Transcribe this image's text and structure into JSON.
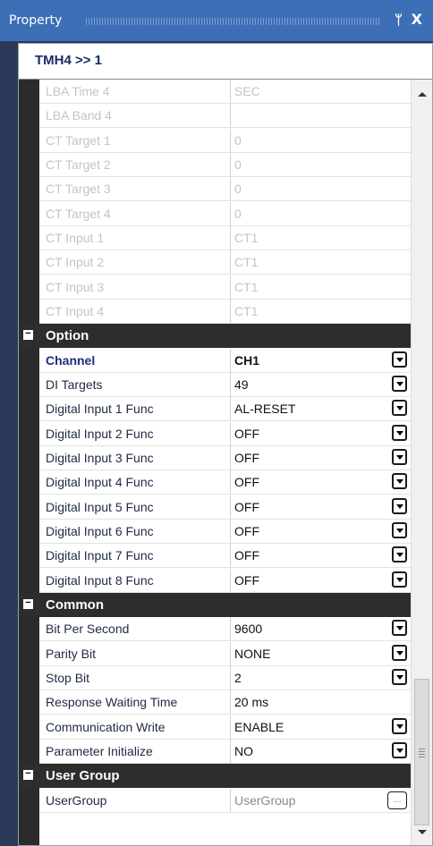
{
  "title": "Property",
  "header": "TMH4 >> 1",
  "sections": [
    {
      "type": "rows",
      "rows": [
        {
          "name": "LBA Time 4",
          "value": "SEC",
          "state": "disabled"
        },
        {
          "name": "LBA Band 4",
          "value": "",
          "state": "disabled"
        },
        {
          "name": "CT Target 1",
          "value": "0",
          "state": "disabled"
        },
        {
          "name": "CT Target 2",
          "value": "0",
          "state": "disabled"
        },
        {
          "name": "CT Target 3",
          "value": "0",
          "state": "disabled"
        },
        {
          "name": "CT Target 4",
          "value": "0",
          "state": "disabled"
        },
        {
          "name": "CT Input 1",
          "value": "CT1",
          "state": "disabled"
        },
        {
          "name": "CT Input 2",
          "value": "CT1",
          "state": "disabled"
        },
        {
          "name": "CT Input 3",
          "value": "CT1",
          "state": "disabled"
        },
        {
          "name": "CT Input 4",
          "value": "CT1",
          "state": "disabled"
        }
      ]
    },
    {
      "type": "category",
      "label": "Option",
      "toggle": "−",
      "rows": [
        {
          "name": "Channel",
          "value": "CH1",
          "state": "selected",
          "control": "dropdown"
        },
        {
          "name": "DI Targets",
          "value": "49",
          "control": "dropdown"
        },
        {
          "name": "Digital Input 1 Func",
          "value": "AL-RESET",
          "control": "dropdown"
        },
        {
          "name": "Digital Input 2 Func",
          "value": "OFF",
          "control": "dropdown"
        },
        {
          "name": "Digital Input 3 Func",
          "value": "OFF",
          "control": "dropdown"
        },
        {
          "name": "Digital Input 4 Func",
          "value": "OFF",
          "control": "dropdown"
        },
        {
          "name": "Digital Input 5 Func",
          "value": "OFF",
          "control": "dropdown"
        },
        {
          "name": "Digital Input 6 Func",
          "value": "OFF",
          "control": "dropdown"
        },
        {
          "name": "Digital Input 7 Func",
          "value": "OFF",
          "control": "dropdown"
        },
        {
          "name": "Digital Input 8 Func",
          "value": "OFF",
          "control": "dropdown"
        }
      ]
    },
    {
      "type": "category",
      "label": "Common",
      "toggle": "−",
      "rows": [
        {
          "name": "Bit Per Second",
          "value": "9600",
          "control": "dropdown"
        },
        {
          "name": "Parity Bit",
          "value": "NONE",
          "control": "dropdown"
        },
        {
          "name": "Stop Bit",
          "value": "2",
          "control": "dropdown"
        },
        {
          "name": "Response Waiting Time",
          "value": "20 ms"
        },
        {
          "name": "Communication Write",
          "value": "ENABLE",
          "control": "dropdown"
        },
        {
          "name": "Parameter Initialize",
          "value": "NO",
          "control": "dropdown"
        }
      ]
    },
    {
      "type": "category",
      "label": "User Group",
      "toggle": "−",
      "rows": [
        {
          "name": "UserGroup",
          "value": "UserGroup",
          "state": "gray",
          "control": "ellipsis",
          "ellipsis": "..."
        }
      ]
    }
  ],
  "icons": {
    "pin": "pin-icon",
    "close": "close-icon"
  },
  "pin_glyph": "ᛘ",
  "close_glyph": "X",
  "colors": {
    "titlebar": "#3d6fb7",
    "category": "#2d2d2d",
    "disabled_text": "#c4c4c4",
    "selected_text": "#1e2f7a"
  }
}
